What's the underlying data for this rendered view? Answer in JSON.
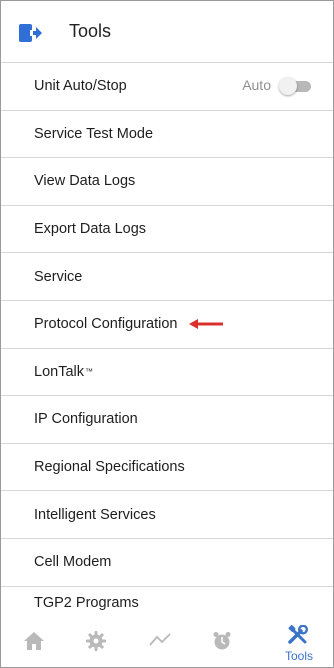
{
  "header": {
    "title": "Tools",
    "back_icon": "exit-arrow-icon",
    "accent_color": "#2f6fd6"
  },
  "menu": {
    "items": [
      {
        "label": "Unit Auto/Stop",
        "toggle_label": "Auto",
        "toggle_on": false
      },
      {
        "label": "Service Test Mode"
      },
      {
        "label": "View Data Logs"
      },
      {
        "label": "Export Data Logs"
      },
      {
        "label": "Service"
      },
      {
        "label": "Protocol Configuration",
        "annotation": "red-arrow-left-icon"
      },
      {
        "label": "LonTalk",
        "superscript": "™"
      },
      {
        "label": "IP Configuration"
      },
      {
        "label": "Regional Specifications"
      },
      {
        "label": "Intelligent Services"
      },
      {
        "label": "Cell Modem"
      },
      {
        "label": "TGP2 Programs"
      }
    ]
  },
  "tabbar": {
    "tabs": [
      {
        "icon": "home-icon",
        "label": "",
        "active": false
      },
      {
        "icon": "gear-icon",
        "label": "",
        "active": false
      },
      {
        "icon": "trend-line-icon",
        "label": "",
        "active": false
      },
      {
        "icon": "alarm-clock-icon",
        "label": "",
        "active": false
      },
      {
        "icon": "tools-icon",
        "label": "Tools",
        "active": true
      }
    ],
    "active_color": "#3b73c8",
    "inactive_color": "#b9b9b9"
  }
}
